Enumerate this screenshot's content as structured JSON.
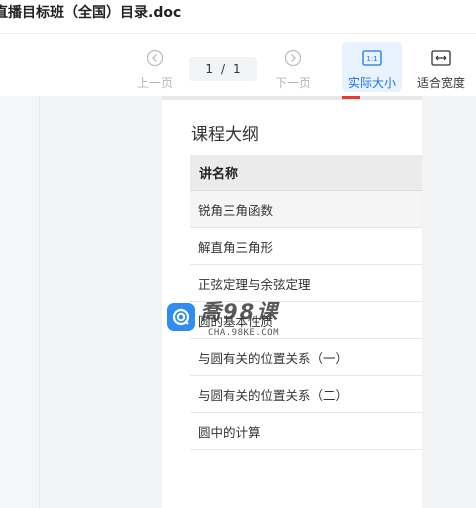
{
  "window": {
    "title": "直播目标班（全国）目录.doc"
  },
  "toolbar": {
    "prev_label": "上一页",
    "next_label": "下一页",
    "actual_size_label": "实际大小",
    "fit_width_label": "适合宽度",
    "actual_size_icon_text": "1:1"
  },
  "pager": {
    "current": "1",
    "separator": "/",
    "total": "1"
  },
  "document": {
    "heading": "课程大纲",
    "table_header": "讲名称",
    "rows": [
      "锐角三角函数",
      "解直角三角形",
      "正弦定理与余弦定理",
      "圆的基本性质",
      "与圆有关的位置关系（一）",
      "与圆有关的位置关系（二）",
      "圆中的计算"
    ]
  },
  "watermark": {
    "text": "喬98课",
    "url": "CHA.98KE.COM"
  },
  "colors": {
    "accent": "#1a73e8",
    "active_bg": "#e9f3ff",
    "watermark_icon": "#2f8cf0"
  }
}
